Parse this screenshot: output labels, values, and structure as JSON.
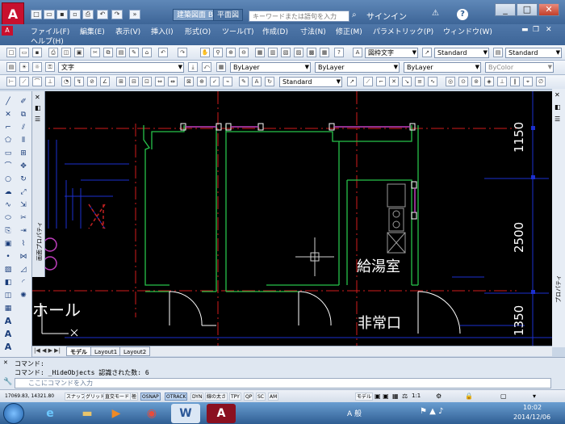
{
  "titlebar": {
    "doc_tabs": [
      "建築図面 B",
      "平面図"
    ],
    "search_placeholder": "キーワードまたは語句を入力",
    "signin": "サインイン",
    "help_btn": "?"
  },
  "menubar": {
    "row1": [
      "ファイル(F)",
      "編集(E)",
      "表示(V)",
      "挿入(I)",
      "形式(O)",
      "ツール(T)",
      "作成(D)",
      "寸法(N)",
      "修正(M)",
      "パラメトリック(P)",
      "ウィンドウ(W)"
    ],
    "row2": [
      "ヘルプ(H)"
    ]
  },
  "toolbar": {
    "textstyle": "文字",
    "dimstyle": "図枠文字",
    "style1": "Standard",
    "style2": "Standard",
    "layer": "ByLayer",
    "linetype": "ByLayer",
    "lineweight": "ByLayer",
    "color": "ByColor",
    "dimstyle2": "Standard"
  },
  "drawing": {
    "room_hall": "ホール",
    "room_kitchen": "給湯室",
    "room_exit": "非常口",
    "dim1": "1150",
    "dim2": "2500",
    "dim3": "1350",
    "left_panel_label": "画面プロパティ",
    "right_panel_label": "プロパティ"
  },
  "layout_tabs": [
    "モデル",
    "Layout1",
    "Layout2"
  ],
  "command": {
    "line1": "コマンド:",
    "line2": "コマンド: _HideObjects 認識された数: 6",
    "placeholder": "ここにコマンドを入力"
  },
  "statusbar": {
    "coords": "17069.83, 14321.80",
    "buttons": [
      "スナップ",
      "グリッド",
      "直交モード",
      "極",
      "OSNAP",
      "OTRACK",
      "DYN",
      "線の太さ",
      "TPY",
      "QP",
      "SC",
      "AM"
    ],
    "model": "モデル",
    "scale": "1:1"
  },
  "taskbar": {
    "time": "10:02",
    "date": "2014/12/06",
    "ime": "A 般"
  }
}
